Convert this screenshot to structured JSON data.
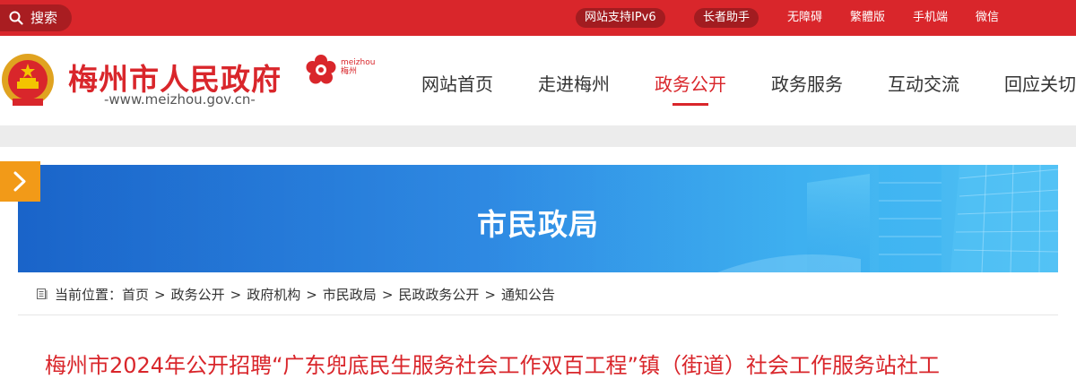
{
  "topbar": {
    "search_placeholder": "搜索",
    "links": [
      "网站支持IPv6",
      "长者助手",
      "无障碍",
      "繁體版",
      "手机端",
      "微信"
    ]
  },
  "header": {
    "site_title": "梅州市人民政府",
    "site_url": "-www.meizhou.gov.cn-",
    "city_logo_text_en": "meizhou",
    "city_logo_text_cn": "梅州",
    "nav": [
      "网站首页",
      "走进梅州",
      "政务公开",
      "政务服务",
      "互动交流",
      "回应关切"
    ],
    "active_nav": "政务公开"
  },
  "banner": {
    "title": "市民政局"
  },
  "breadcrumb": {
    "label": "当前位置：",
    "items": [
      "首页",
      "政务公开",
      "政府机构",
      "市民政局",
      "民政政务公开",
      "通知公告"
    ],
    "separator": ">"
  },
  "article": {
    "title": "梅州市2024年公开招聘“广东兜底民生服务社会工作双百工程”镇（街道）社会工作服务站社工"
  },
  "colors": {
    "brand_red": "#d9262b",
    "banner_blue": "#1c7fe0",
    "side_tab_orange": "#f29a18"
  }
}
